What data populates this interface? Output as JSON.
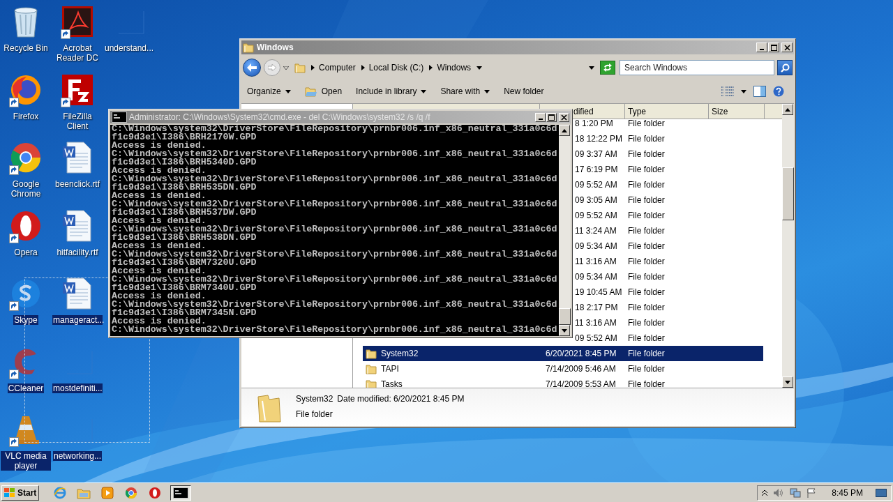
{
  "desktop": {
    "columns": [
      [
        {
          "label": "Recycle Bin",
          "kind": "recycle-bin",
          "shortcut": false,
          "selected": false
        },
        {
          "label": "Firefox",
          "kind": "firefox",
          "shortcut": true,
          "selected": false
        },
        {
          "label": "Google Chrome",
          "kind": "chrome",
          "shortcut": true,
          "selected": false
        },
        {
          "label": "Opera",
          "kind": "opera",
          "shortcut": true,
          "selected": false
        },
        {
          "label": "Skype",
          "kind": "skype",
          "shortcut": true,
          "selected": true
        },
        {
          "label": "CCleaner",
          "kind": "ccleaner",
          "shortcut": true,
          "selected": true
        },
        {
          "label": "VLC media player",
          "kind": "vlc",
          "shortcut": true,
          "selected": true
        }
      ],
      [
        {
          "label": "Acrobat Reader DC",
          "kind": "pdf",
          "shortcut": true,
          "selected": false
        },
        {
          "label": "FileZilla Client",
          "kind": "filezilla",
          "shortcut": true,
          "selected": false
        },
        {
          "label": "beenclick.rtf",
          "kind": "word",
          "shortcut": false,
          "selected": false
        },
        {
          "label": "hitfacility.rtf",
          "kind": "word",
          "shortcut": false,
          "selected": false
        },
        {
          "label": "manageract...",
          "kind": "word",
          "shortcut": false,
          "selected": true
        },
        {
          "label": "mostdefiniti...",
          "kind": "blank",
          "shortcut": false,
          "selected": true
        },
        {
          "label": "networking...",
          "kind": "blank",
          "shortcut": false,
          "selected": true
        }
      ],
      [
        {
          "label": "understand...",
          "kind": "blank",
          "shortcut": false,
          "selected": false
        }
      ]
    ]
  },
  "explorer": {
    "title": "Windows",
    "breadcrumb": [
      "Computer",
      "Local Disk (C:)",
      "Windows"
    ],
    "search": {
      "placeholder": "Search Windows"
    },
    "toolbar": [
      {
        "label": "Organize",
        "kind": "menu"
      },
      {
        "label": "Open",
        "kind": "open"
      },
      {
        "label": "Include in library",
        "kind": "menu"
      },
      {
        "label": "Share with",
        "kind": "menu"
      },
      {
        "label": "New folder",
        "kind": "plain"
      }
    ],
    "columns": [
      {
        "label": "dified",
        "kind": "partial"
      },
      {
        "label": "Type",
        "kind": "full"
      },
      {
        "label": "Size",
        "kind": "full"
      }
    ],
    "rows": [
      {
        "kind": "partial",
        "date": "8 1:20 PM",
        "type": "File folder",
        "selected": false
      },
      {
        "kind": "partial",
        "date": "18 12:22 PM",
        "type": "File folder",
        "selected": false
      },
      {
        "kind": "partial",
        "date": "09 3:37 AM",
        "type": "File folder",
        "selected": false
      },
      {
        "kind": "partial",
        "date": "17 6:19 PM",
        "type": "File folder",
        "selected": false
      },
      {
        "kind": "partial",
        "date": "09 5:52 AM",
        "type": "File folder",
        "selected": false
      },
      {
        "kind": "partial",
        "date": "09 3:05 AM",
        "type": "File folder",
        "selected": false
      },
      {
        "kind": "partial",
        "date": "09 5:52 AM",
        "type": "File folder",
        "selected": false
      },
      {
        "kind": "partial",
        "date": "11 3:24 AM",
        "type": "File folder",
        "selected": false
      },
      {
        "kind": "partial",
        "date": "09 5:34 AM",
        "type": "File folder",
        "selected": false
      },
      {
        "kind": "partial",
        "date": "11 3:16 AM",
        "type": "File folder",
        "selected": false
      },
      {
        "kind": "partial",
        "date": "09 5:34 AM",
        "type": "File folder",
        "selected": false
      },
      {
        "kind": "partial",
        "date": "19 10:45 AM",
        "type": "File folder",
        "selected": false
      },
      {
        "kind": "partial",
        "date": "18 2:17 PM",
        "type": "File folder",
        "selected": false
      },
      {
        "kind": "partial",
        "date": "11 3:16 AM",
        "type": "File folder",
        "selected": false
      },
      {
        "kind": "partial",
        "date": "09 5:52 AM",
        "type": "File folder",
        "selected": false
      },
      {
        "kind": "full",
        "name": "System32",
        "date": "6/20/2021 8:45 PM",
        "type": "File folder",
        "selected": true
      },
      {
        "kind": "full",
        "name": "TAPI",
        "date": "7/14/2009 5:46 AM",
        "type": "File folder",
        "selected": false
      },
      {
        "kind": "full",
        "name": "Tasks",
        "date": "7/14/2009 5:53 AM",
        "type": "File folder",
        "selected": false
      }
    ],
    "details": {
      "name": "System32",
      "date_label": "Date modified:",
      "date": "6/20/2021 8:45 PM",
      "type": "File folder"
    }
  },
  "cmd": {
    "title": "Administrator: C:\\Windows\\System32\\cmd.exe - del  C:\\Windows\\system32 /s /q /f",
    "lines": [
      "C:\\Windows\\system32\\DriverStore\\FileRepository\\prnbr006.inf_x86_neutral_331a0c6d",
      "f1c9d3e1\\I386\\BRH2170W.GPD",
      "Access is denied.",
      "C:\\Windows\\system32\\DriverStore\\FileRepository\\prnbr006.inf_x86_neutral_331a0c6d",
      "f1c9d3e1\\I386\\BRH5340D.GPD",
      "Access is denied.",
      "C:\\Windows\\system32\\DriverStore\\FileRepository\\prnbr006.inf_x86_neutral_331a0c6d",
      "f1c9d3e1\\I386\\BRH535DN.GPD",
      "Access is denied.",
      "C:\\Windows\\system32\\DriverStore\\FileRepository\\prnbr006.inf_x86_neutral_331a0c6d",
      "f1c9d3e1\\I386\\BRH537DW.GPD",
      "Access is denied.",
      "C:\\Windows\\system32\\DriverStore\\FileRepository\\prnbr006.inf_x86_neutral_331a0c6d",
      "f1c9d3e1\\I386\\BRH538DN.GPD",
      "Access is denied.",
      "C:\\Windows\\system32\\DriverStore\\FileRepository\\prnbr006.inf_x86_neutral_331a0c6d",
      "f1c9d3e1\\I386\\BRM7320U.GPD",
      "Access is denied.",
      "C:\\Windows\\system32\\DriverStore\\FileRepository\\prnbr006.inf_x86_neutral_331a0c6d",
      "f1c9d3e1\\I386\\BRM7340U.GPD",
      "Access is denied.",
      "C:\\Windows\\system32\\DriverStore\\FileRepository\\prnbr006.inf_x86_neutral_331a0c6d",
      "f1c9d3e1\\I386\\BRM7345N.GPD",
      "Access is denied.",
      "C:\\Windows\\system32\\DriverStore\\FileRepository\\prnbr006.inf_x86_neutral_331a0c6d"
    ]
  },
  "taskbar": {
    "start": "Start",
    "apps": [
      {
        "kind": "ie",
        "active": false
      },
      {
        "kind": "explorer",
        "active": false
      },
      {
        "kind": "media",
        "active": false
      },
      {
        "kind": "chrome",
        "active": false
      },
      {
        "kind": "opera",
        "active": false
      },
      {
        "kind": "cmd",
        "active": true
      }
    ],
    "clock": "8:45 PM"
  }
}
